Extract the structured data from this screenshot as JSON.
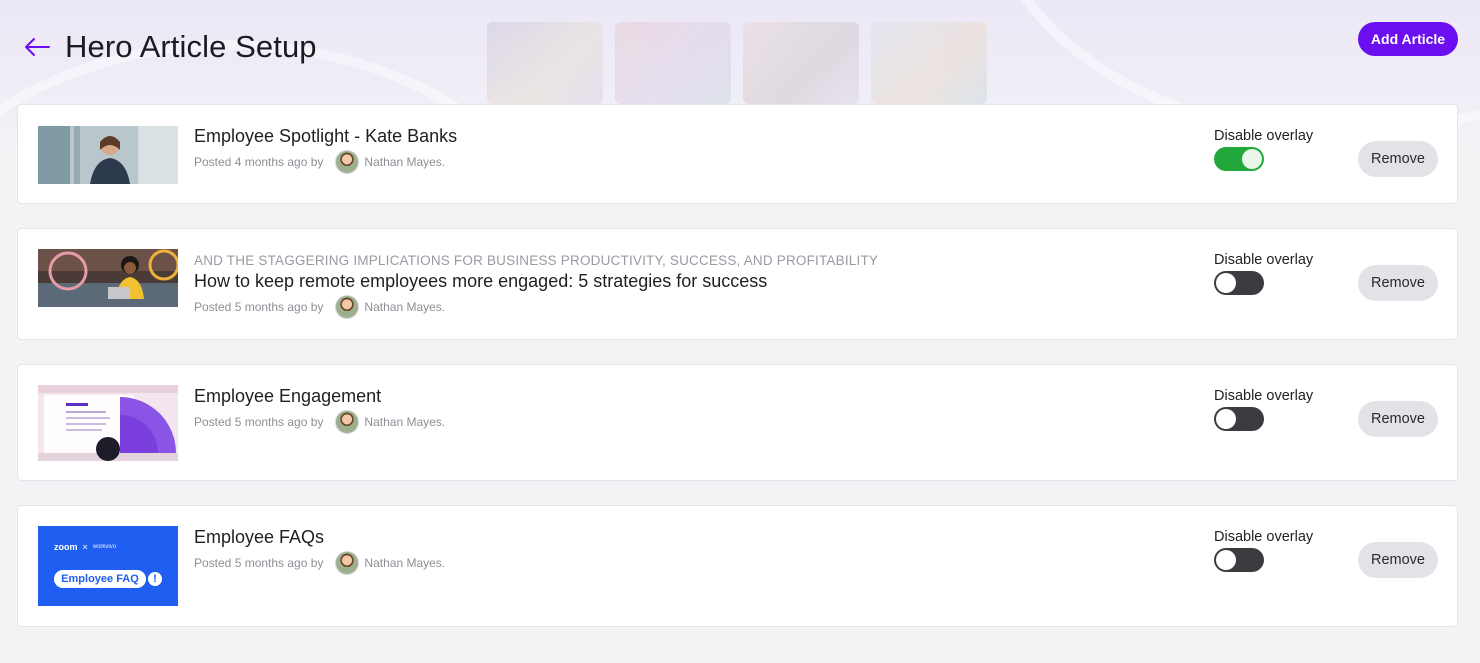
{
  "header": {
    "title": "Hero Article Setup",
    "add_button_label": "Add Article"
  },
  "colors": {
    "accent": "#6c0ff0",
    "toggle_on": "#22a83a",
    "toggle_off": "#3c3c40",
    "remove_bg": "#e3e3e7"
  },
  "articles": [
    {
      "kicker": "",
      "title": "Employee Spotlight - Kate Banks",
      "posted": "Posted 4 months ago by",
      "author": "Nathan Mayes.",
      "overlay_label": "Disable overlay",
      "overlay_disabled": true,
      "remove_label": "Remove"
    },
    {
      "kicker": "AND THE STAGGERING IMPLICATIONS FOR BUSINESS PRODUCTIVITY, SUCCESS, AND PROFITABILITY",
      "title": "How to keep remote employees more engaged: 5 strategies for success",
      "posted": "Posted 5 months ago by",
      "author": "Nathan Mayes.",
      "overlay_label": "Disable overlay",
      "overlay_disabled": false,
      "remove_label": "Remove"
    },
    {
      "kicker": "",
      "title": "Employee Engagement",
      "posted": "Posted 5 months ago by",
      "author": "Nathan Mayes.",
      "overlay_label": "Disable overlay",
      "overlay_disabled": false,
      "remove_label": "Remove"
    },
    {
      "kicker": "",
      "title": "Employee FAQs",
      "posted": "Posted 5 months ago by",
      "author": "Nathan Mayes.",
      "overlay_label": "Disable overlay",
      "overlay_disabled": false,
      "remove_label": "Remove",
      "thumbnail_text": {
        "brand": "zoom",
        "sep": "×",
        "partner": "workvivo",
        "banner": "Employee FAQ",
        "badge": "!"
      }
    }
  ]
}
